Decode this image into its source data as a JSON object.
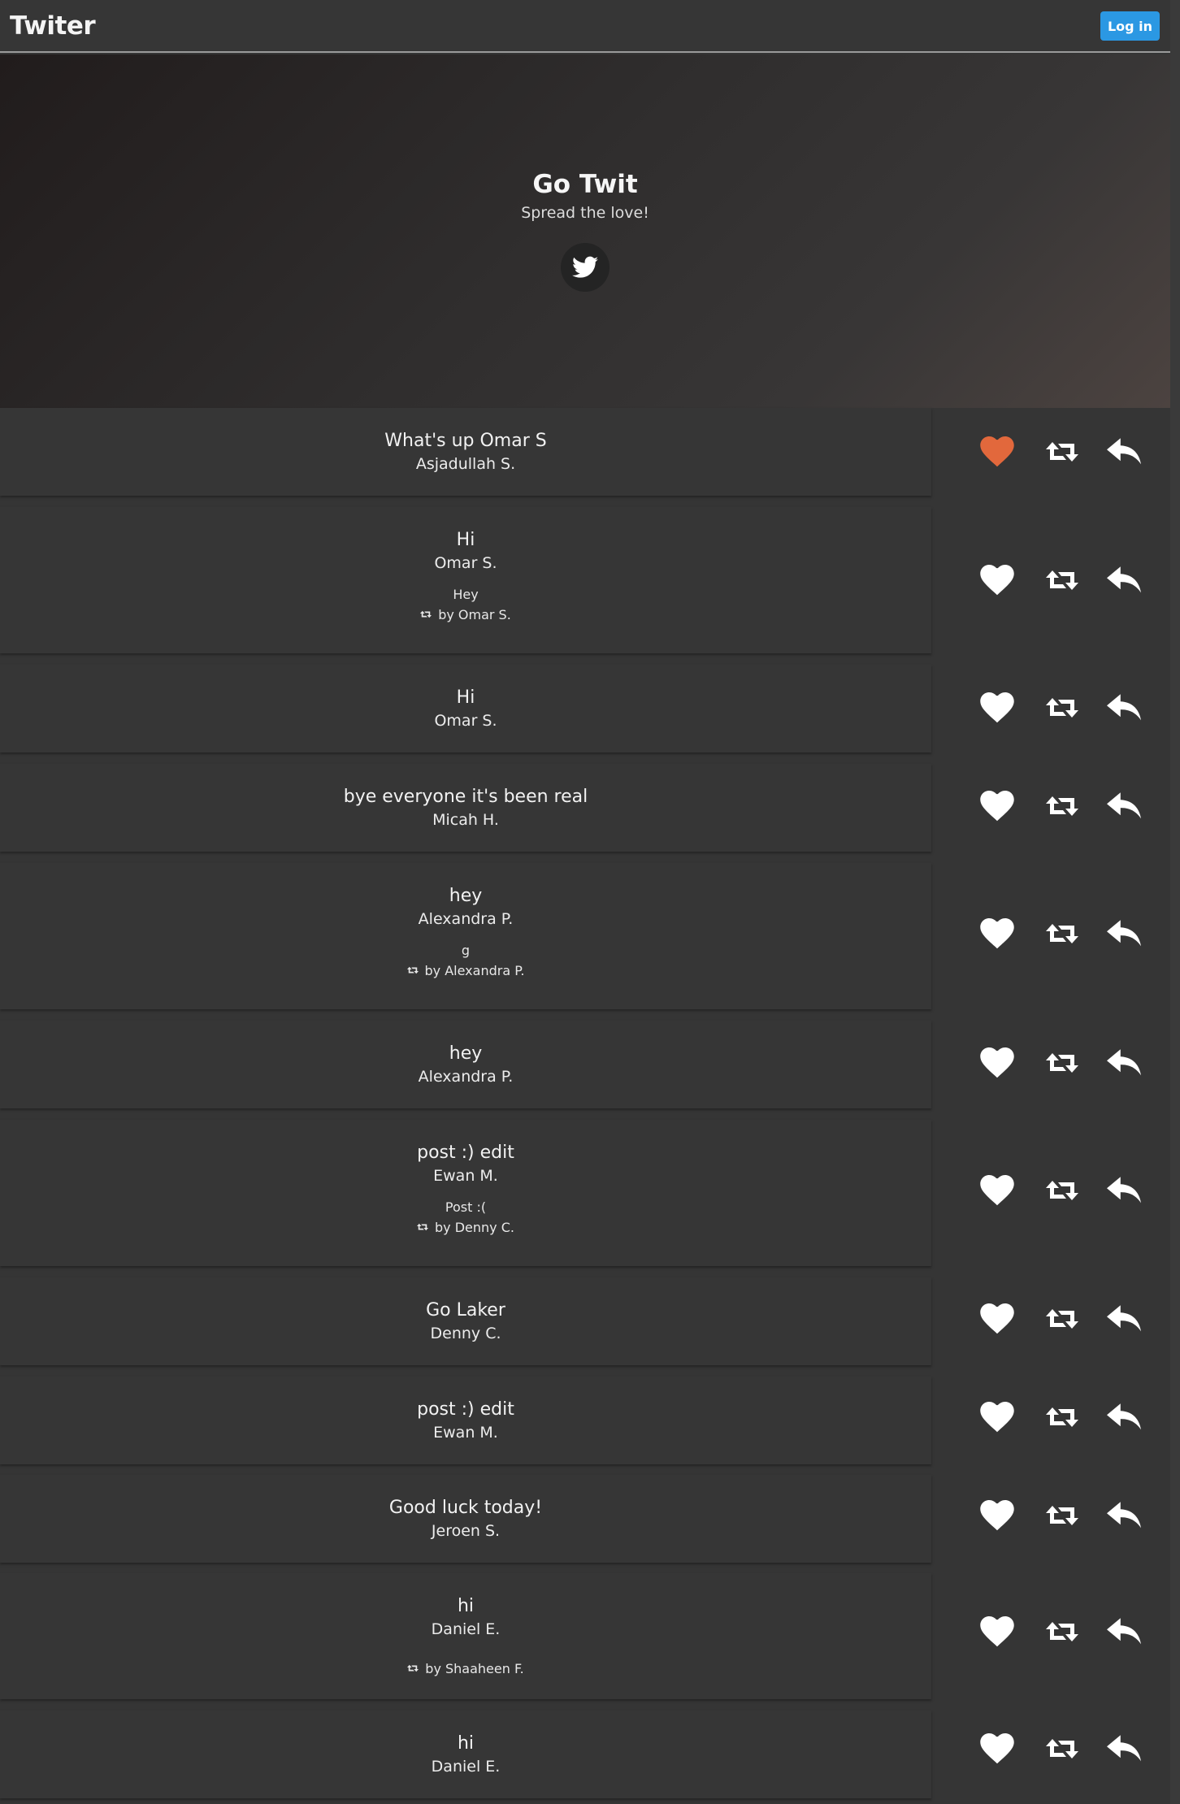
{
  "navbar": {
    "brand": "Twiter",
    "login_label": "Log in"
  },
  "hero": {
    "title": "Go Twit",
    "subtitle": "Spread the love!"
  },
  "colors": {
    "liked": "#e2683c",
    "icon": "#ffffff",
    "login_button": "#2b98e3"
  },
  "tweets": [
    {
      "text": "What's up Omar S",
      "author": "Asjadullah S.",
      "liked": true
    },
    {
      "text": "Hi",
      "author": "Omar S.",
      "liked": false,
      "retweet_text": "Hey",
      "retweet_by": "by Omar S."
    },
    {
      "text": "Hi",
      "author": "Omar S.",
      "liked": false
    },
    {
      "text": "bye everyone it's been real",
      "author": "Micah H.",
      "liked": false
    },
    {
      "text": "hey",
      "author": "Alexandra P.",
      "liked": false,
      "retweet_text": "g",
      "retweet_by": "by Alexandra P."
    },
    {
      "text": "hey",
      "author": "Alexandra P.",
      "liked": false
    },
    {
      "text": "post :) edit",
      "author": "Ewan M.",
      "liked": false,
      "retweet_text": "Post :(",
      "retweet_by": "by Denny C."
    },
    {
      "text": "Go Laker",
      "author": "Denny C.",
      "liked": false
    },
    {
      "text": "post :) edit",
      "author": "Ewan M.",
      "liked": false
    },
    {
      "text": "Good luck today!",
      "author": "Jeroen S.",
      "liked": false
    },
    {
      "text": "hi",
      "author": "Daniel E.",
      "liked": false,
      "retweet_by": "by Shaaheen F."
    },
    {
      "text": "hi",
      "author": "Daniel E.",
      "liked": false
    }
  ]
}
